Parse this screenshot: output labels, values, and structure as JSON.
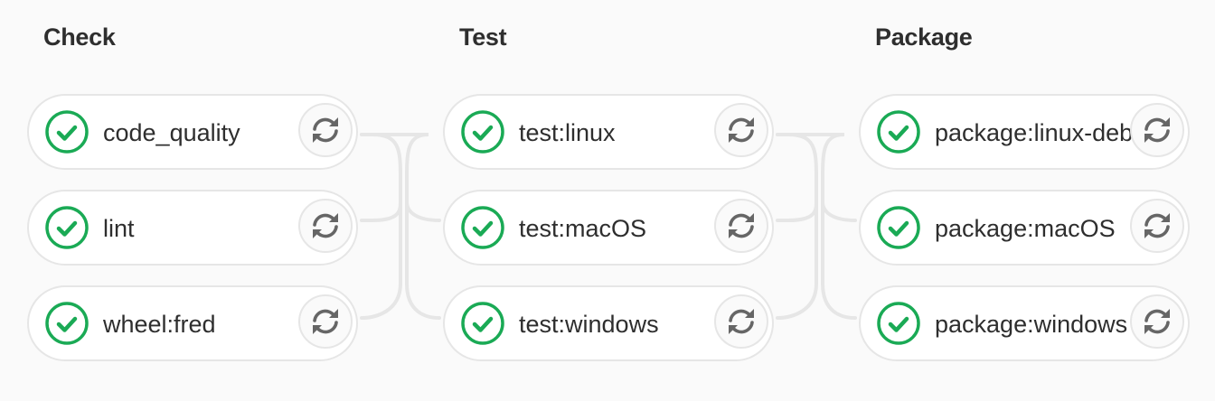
{
  "stages": [
    {
      "title": "Check",
      "jobs": [
        {
          "name": "code_quality",
          "status": "success",
          "action": "retry"
        },
        {
          "name": "lint",
          "status": "success",
          "action": "retry"
        },
        {
          "name": "wheel:fred",
          "status": "success",
          "action": "retry"
        }
      ]
    },
    {
      "title": "Test",
      "jobs": [
        {
          "name": "test:linux",
          "status": "success",
          "action": "retry"
        },
        {
          "name": "test:macOS",
          "status": "success",
          "action": "retry"
        },
        {
          "name": "test:windows",
          "status": "success",
          "action": "retry"
        }
      ]
    },
    {
      "title": "Package",
      "jobs": [
        {
          "name": "package:linux-deb",
          "status": "success",
          "action": "retry"
        },
        {
          "name": "package:macOS",
          "status": "success",
          "action": "retry"
        },
        {
          "name": "package:windows",
          "status": "success",
          "action": "retry"
        }
      ]
    }
  ],
  "icons": {
    "status": "check-circle-icon",
    "action": "retry-icon"
  },
  "colors": {
    "success": "#1aaa55",
    "connector": "#e6e6e6",
    "retry_icon": "#666666",
    "text": "#2e2e2e",
    "background": "#fafafa"
  }
}
